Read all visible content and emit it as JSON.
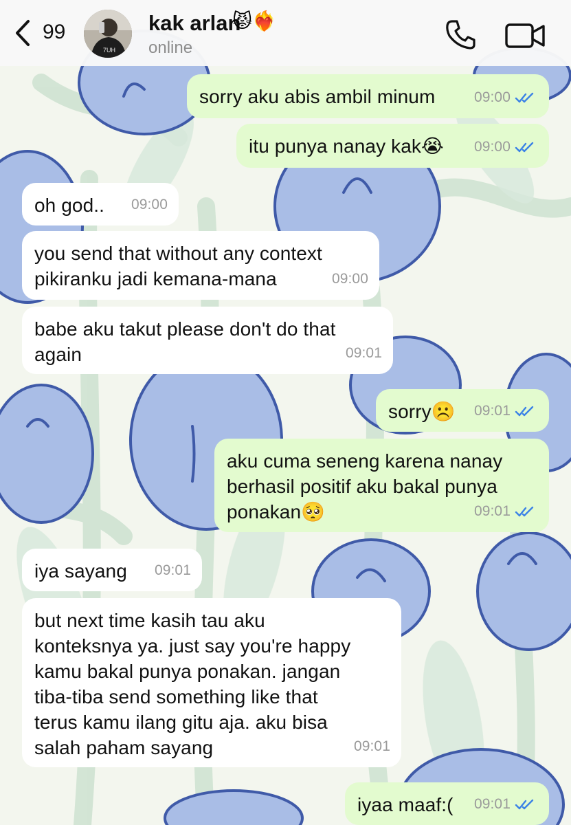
{
  "header": {
    "back_count": "99",
    "contact_name": "kak arlan",
    "contact_emoji": "😾❤️‍🔥",
    "contact_status": "online",
    "avatar_text": "7UH"
  },
  "messages": [
    {
      "dir": "out",
      "text": "sorry aku abis ambil minum",
      "time": "09:00",
      "read": true
    },
    {
      "dir": "out",
      "text": "itu punya nanay kak😭",
      "time": "09:00",
      "read": true
    },
    {
      "dir": "in",
      "text": "oh god..",
      "time": "09:00"
    },
    {
      "dir": "in",
      "text": "you send that without any context\npikiranku jadi kemana-mana",
      "time": "09:00"
    },
    {
      "dir": "in",
      "text": "babe aku takut please don't do that\nagain",
      "time": "09:01"
    },
    {
      "dir": "out",
      "text": "sorry☹️",
      "time": "09:01",
      "read": true
    },
    {
      "dir": "out",
      "text": "aku cuma seneng karena nanay\nberhasil positif aku bakal punya\nponakan🥺",
      "time": "09:01",
      "read": true
    },
    {
      "dir": "in",
      "text": "iya sayang",
      "time": "09:01"
    },
    {
      "dir": "in",
      "text": "but next time kasih tau aku\nkonteksnya ya. just say you're happy\nkamu bakal punya ponakan. jangan\ntiba-tiba send something like that\nterus kamu ilang gitu aja. aku bisa\nsalah paham sayang",
      "time": "09:01"
    },
    {
      "dir": "out",
      "text": "iyaa maaf:(",
      "time": "09:01",
      "read": true
    }
  ],
  "colors": {
    "incoming_bubble": "#ffffff",
    "outgoing_bubble": "#e3fbcf",
    "read_ticks": "#3b82e6",
    "wallpaper_flower": "#a9bde6",
    "wallpaper_leaf": "#cfe3d2"
  },
  "icons": {
    "back": "chevron-left-icon",
    "call": "phone-icon",
    "video": "video-camera-icon"
  }
}
